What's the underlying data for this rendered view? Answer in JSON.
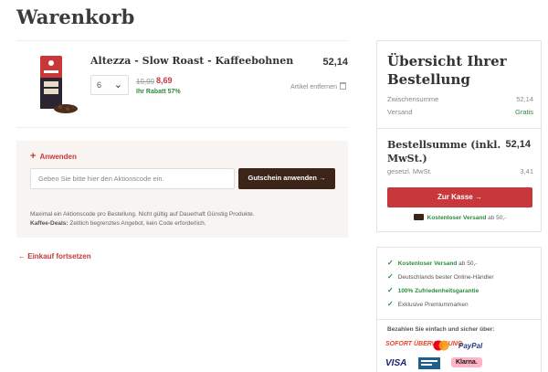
{
  "page": {
    "title": "Warenkorb"
  },
  "item": {
    "name": "Altezza - Slow Roast - Kaffeebohnen",
    "image_alt": "Altezza Slow Roast Kaffeebohnen Packung",
    "qty": "6",
    "old_price": "19,99",
    "new_price": "8,69",
    "savings": "Ihr Rabatt 57%",
    "total": "52,14",
    "remove": "Artikel entfernen"
  },
  "promo": {
    "toggle": "Anwenden",
    "placeholder": "Geben Sie bitte hier den Aktionscode ein.",
    "button": "Gutschein anwenden",
    "note_line1": "Maximal ein Aktionscode pro Bestellung. Nicht gültig auf Dauerhaft Günstig Produkte.",
    "note_bold": "Kaffee-Deals:",
    "note_line2": "Zeitlich begrenztes Angebot, kein Code erforderlich."
  },
  "continue": "Einkauf fortsetzen",
  "summary": {
    "title": "Übersicht Ihrer Bestellung",
    "subtotal_label": "Zwischensumme",
    "subtotal_value": "52,14",
    "shipping_label": "Versand",
    "shipping_value": "Gratis",
    "total_label": "Bestellsumme (inkl. MwSt.)",
    "total_value": "52,14",
    "tax_label": "gesetzl. MwSt.",
    "tax_value": "3,41",
    "checkout": "Zur Kasse",
    "free_ship_bold": "Kostenloser Versand",
    "free_ship_rest": "ab 50,-"
  },
  "trust": {
    "items": [
      {
        "bold": "Kostenloser Versand",
        "rest": " ab 50,-"
      },
      {
        "bold": "",
        "rest": "Deutschlands bester Online-Händler"
      },
      {
        "bold": "100% Zufriedenheitsgarantie",
        "rest": ""
      },
      {
        "bold": "",
        "rest": "Exklusive Premiummarken"
      }
    ],
    "payment_title": "Bezahlen Sie einfach und sicher über:",
    "payments": [
      "SOFORT ÜBERWEISUNG",
      "Mastercard",
      "PayPal",
      "VISA",
      "Klarna."
    ]
  },
  "colors": {
    "accent": "#c8373a",
    "dark": "#3d2418",
    "green": "#2e8b3e"
  }
}
